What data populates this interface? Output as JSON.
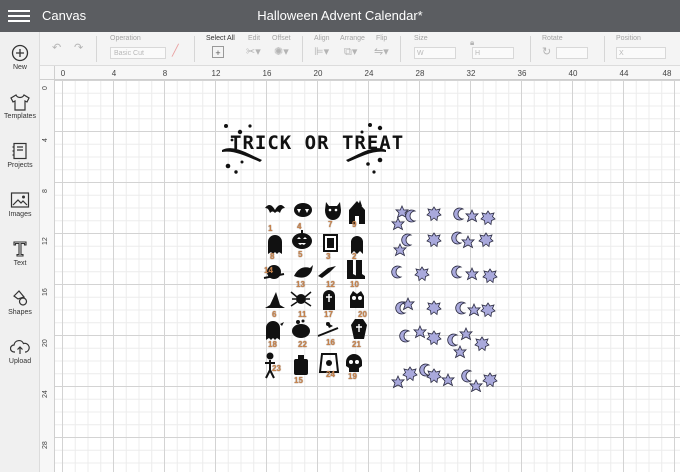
{
  "app": {
    "name": "Canvas",
    "document_title": "Halloween Advent Calendar*"
  },
  "toolbar": {
    "operation_label": "Operation",
    "operation_value": "Basic Cut",
    "select_all_label": "Select All",
    "edit_label": "Edit",
    "offset_label": "Offset",
    "align_label": "Align",
    "arrange_label": "Arrange",
    "flip_label": "Flip",
    "size_label": "Size",
    "size_w": "W",
    "size_h": "H",
    "rotate_label": "Rotate",
    "position_label": "Position",
    "position_x": "X"
  },
  "sidebar": {
    "items": [
      {
        "label": "New",
        "icon": "plus-icon"
      },
      {
        "label": "Templates",
        "icon": "shirt-icon"
      },
      {
        "label": "Projects",
        "icon": "projects-icon"
      },
      {
        "label": "Images",
        "icon": "image-icon"
      },
      {
        "label": "Text",
        "icon": "text-icon"
      },
      {
        "label": "Shapes",
        "icon": "shapes-icon"
      },
      {
        "label": "Upload",
        "icon": "upload-icon"
      }
    ]
  },
  "rulers": {
    "top": [
      "0",
      "4",
      "8",
      "12",
      "16",
      "20",
      "24",
      "28",
      "32",
      "36",
      "40",
      "44",
      "48"
    ],
    "left": [
      "0",
      "4",
      "8",
      "12",
      "16",
      "20",
      "24",
      "28"
    ]
  },
  "design": {
    "title_text": "TRICK OR TREAT",
    "calendar_numbers": [
      "1",
      "4",
      "7",
      "9",
      "8",
      "5",
      "3",
      "2",
      "14",
      "13",
      "12",
      "10",
      "6",
      "11",
      "17",
      "20",
      "18",
      "22",
      "16",
      "21",
      "23",
      "15",
      "24",
      "19"
    ],
    "accent_color": "#c8844e",
    "star_fill": "#a9a9dc"
  }
}
